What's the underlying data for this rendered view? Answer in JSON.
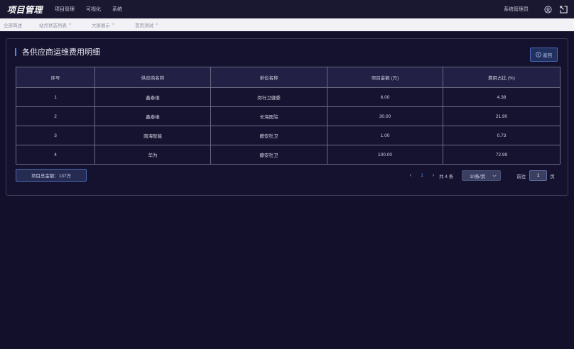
{
  "app": {
    "title": "项目管理"
  },
  "topnav": {
    "items": [
      "项目管理",
      "可视化",
      "系统"
    ]
  },
  "user": {
    "name": "系统管理员"
  },
  "icons": {
    "user": "user-circle-icon",
    "exit": "exit-icon",
    "back": "back-icon",
    "dropdown": "chevron-down-icon"
  },
  "tabs": [
    {
      "label": "全部简述",
      "closable": false
    },
    {
      "label": "站点状态列表",
      "closable": true
    },
    {
      "label": "大屏展示",
      "closable": true
    },
    {
      "label": "首页测试",
      "closable": true
    }
  ],
  "tab_close_glyph": "×",
  "panel": {
    "title": "各供应商运维费用明细",
    "back_label": "返回"
  },
  "table": {
    "headers": [
      "序号",
      "供应商名称",
      "单位名称",
      "项目金额 (万)",
      "费用占比 (%)"
    ],
    "rows": [
      [
        "1",
        "鑫泰维",
        "闵行卫健委",
        "6.00",
        "4.38"
      ],
      [
        "2",
        "鑫泰维",
        "长海医院",
        "30.00",
        "21.90"
      ],
      [
        "3",
        "南海智能",
        "静安社卫",
        "1.00",
        "0.73"
      ],
      [
        "4",
        "华为",
        "静安社卫",
        "100.00",
        "72.99"
      ]
    ]
  },
  "summary": {
    "total_label": "项目总金额：137万"
  },
  "pagination": {
    "prev": "‹",
    "next": "›",
    "current_page": "1",
    "total_text": "共 4 条",
    "page_size": "10条/页",
    "goto_label": "前往",
    "goto_value": "1",
    "page_unit": "页"
  },
  "colors": {
    "background": "#12102a",
    "accent": "#4a86ff",
    "topbar": "#1a1830",
    "tabbar": "#f2f2f6"
  }
}
